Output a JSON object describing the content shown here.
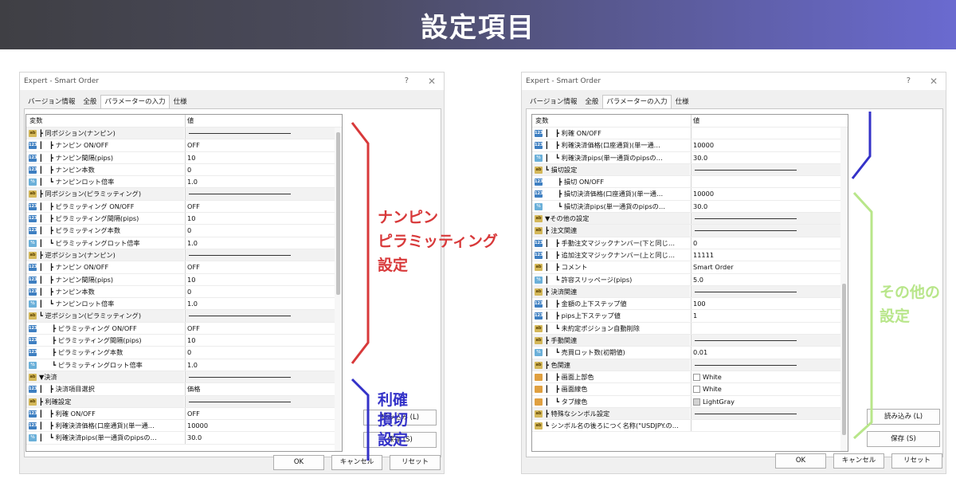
{
  "banner": {
    "title": "設定項目"
  },
  "colors": {
    "red": "#d8393a",
    "blue": "#3432c8",
    "green": "#b8e68a"
  },
  "left_dialog": {
    "title": "Expert - Smart Order",
    "help": "?",
    "close": "✕",
    "tabs": [
      "バージョン情報",
      "全般",
      "パラメーターの入力",
      "仕様"
    ],
    "active_tab": 2,
    "header": {
      "name": "変数",
      "value": "値"
    },
    "rows": [
      {
        "icon": "ab",
        "indent": "┣",
        "name": "同ポジション(ナンピン)",
        "value": "",
        "sep": true
      },
      {
        "icon": "123",
        "indent": "┃　┣",
        "name": "ナンピン ON/OFF",
        "value": "OFF"
      },
      {
        "icon": "123",
        "indent": "┃　┣",
        "name": "ナンピン間隔(pips)",
        "value": "10"
      },
      {
        "icon": "123",
        "indent": "┃　┣",
        "name": "ナンピン本数",
        "value": "0"
      },
      {
        "icon": "½",
        "indent": "┃　┗",
        "name": "ナンピンロット倍率",
        "value": "1.0"
      },
      {
        "icon": "ab",
        "indent": "┣",
        "name": "同ポジション(ピラミッティング)",
        "value": "",
        "sep": true
      },
      {
        "icon": "123",
        "indent": "┃　┣",
        "name": "ピラミッティング ON/OFF",
        "value": "OFF"
      },
      {
        "icon": "123",
        "indent": "┃　┣",
        "name": "ピラミッティング間隔(pips)",
        "value": "10"
      },
      {
        "icon": "123",
        "indent": "┃　┣",
        "name": "ピラミッティング本数",
        "value": "0"
      },
      {
        "icon": "½",
        "indent": "┃　┗",
        "name": "ピラミッティングロット倍率",
        "value": "1.0"
      },
      {
        "icon": "ab",
        "indent": "┣",
        "name": "逆ポジション(ナンピン)",
        "value": "",
        "sep": true
      },
      {
        "icon": "123",
        "indent": "┃　┣",
        "name": "ナンピン ON/OFF",
        "value": "OFF"
      },
      {
        "icon": "123",
        "indent": "┃　┣",
        "name": "ナンピン間隔(pips)",
        "value": "10"
      },
      {
        "icon": "123",
        "indent": "┃　┣",
        "name": "ナンピン本数",
        "value": "0"
      },
      {
        "icon": "½",
        "indent": "┃　┗",
        "name": "ナンピンロット倍率",
        "value": "1.0"
      },
      {
        "icon": "ab",
        "indent": "┗",
        "name": "逆ポジション(ピラミッティング)",
        "value": "",
        "sep": true
      },
      {
        "icon": "123",
        "indent": "　　┣",
        "name": "ピラミッティング ON/OFF",
        "value": "OFF"
      },
      {
        "icon": "123",
        "indent": "　　┣",
        "name": "ピラミッティング間隔(pips)",
        "value": "10"
      },
      {
        "icon": "123",
        "indent": "　　┣",
        "name": "ピラミッティング本数",
        "value": "0"
      },
      {
        "icon": "½",
        "indent": "　　┗",
        "name": "ピラミッティングロット倍率",
        "value": "1.0"
      },
      {
        "icon": "ab",
        "indent": "",
        "name": "▼決済",
        "value": "",
        "sep": true
      },
      {
        "icon": "123",
        "indent": "┃　┣",
        "name": "決済項目選択",
        "value": "価格"
      },
      {
        "icon": "ab",
        "indent": "┣",
        "name": "利確設定",
        "value": "",
        "sep": true
      },
      {
        "icon": "123",
        "indent": "┃　┣",
        "name": "利確 ON/OFF",
        "value": "OFF"
      },
      {
        "icon": "123",
        "indent": "┃　┣",
        "name": "利確決済価格(口座通貨)(単一通…",
        "value": "10000"
      },
      {
        "icon": "½",
        "indent": "┃　┗",
        "name": "利確決済pips(単一通貨のpipsの…",
        "value": "30.0"
      }
    ],
    "load_button": "読み込み (L)",
    "save_button": "保存 (S)",
    "ok_button": "OK",
    "cancel_button": "キャンセル",
    "reset_button": "リセット"
  },
  "right_dialog": {
    "title": "Expert - Smart Order",
    "help": "?",
    "close": "✕",
    "tabs": [
      "バージョン情報",
      "全般",
      "パラメーターの入力",
      "仕様"
    ],
    "active_tab": 2,
    "header": {
      "name": "変数",
      "value": "値"
    },
    "rows": [
      {
        "icon": "123",
        "indent": "┃　┣",
        "name": "利確 ON/OFF",
        "value": ""
      },
      {
        "icon": "123",
        "indent": "┃　┣",
        "name": "利確決済価格(口座通貨)(単一通…",
        "value": "10000"
      },
      {
        "icon": "½",
        "indent": "┃　┗",
        "name": "利確決済pips(単一通貨のpipsの…",
        "value": "30.0"
      },
      {
        "icon": "ab",
        "indent": "┗",
        "name": "損切設定",
        "value": "",
        "sep": true
      },
      {
        "icon": "123",
        "indent": "　　┣",
        "name": "損切 ON/OFF",
        "value": ""
      },
      {
        "icon": "123",
        "indent": "　　┣",
        "name": "損切決済価格(口座通貨)(単一通…",
        "value": "10000"
      },
      {
        "icon": "½",
        "indent": "　　┗",
        "name": "損切決済pips(単一通貨のpipsの…",
        "value": "30.0"
      },
      {
        "icon": "ab",
        "indent": "",
        "name": "▼その他の設定",
        "value": "",
        "sep": true
      },
      {
        "icon": "ab",
        "indent": "┣",
        "name": "注文関連",
        "value": "",
        "sep": true
      },
      {
        "icon": "123",
        "indent": "┃　┣",
        "name": "手動注文マジックナンバー(下と同じ…",
        "value": "0"
      },
      {
        "icon": "123",
        "indent": "┃　┣",
        "name": "追加注文マジックナンバー(上と同じ…",
        "value": "11111"
      },
      {
        "icon": "ab",
        "indent": "┃　┣",
        "name": "コメント",
        "value": "Smart Order"
      },
      {
        "icon": "½",
        "indent": "┃　┗",
        "name": "許容スリッページ(pips)",
        "value": "5.0"
      },
      {
        "icon": "ab",
        "indent": "┣",
        "name": "決済関連",
        "value": "",
        "sep": true
      },
      {
        "icon": "123",
        "indent": "┃　┣",
        "name": "金額の上下ステップ値",
        "value": "100"
      },
      {
        "icon": "123",
        "indent": "┃　┣",
        "name": "pips上下ステップ値",
        "value": "1"
      },
      {
        "icon": "ab",
        "indent": "┃　┗",
        "name": "未約定ポジション自動削除",
        "value": ""
      },
      {
        "icon": "ab",
        "indent": "┣",
        "name": "手動関連",
        "value": "",
        "sep": true
      },
      {
        "icon": "½",
        "indent": "┃　┗",
        "name": "売買ロット数(初期値)",
        "value": "0.01"
      },
      {
        "icon": "ab",
        "indent": "┣",
        "name": "色関連",
        "value": "",
        "sep": true
      },
      {
        "icon": "col",
        "indent": "┃　┣",
        "name": "画面上部色",
        "value": "White",
        "swatch": "#ffffff"
      },
      {
        "icon": "col",
        "indent": "┃　┣",
        "name": "画面線色",
        "value": "White",
        "swatch": "#ffffff"
      },
      {
        "icon": "col",
        "indent": "┃　┗",
        "name": "タブ線色",
        "value": "LightGray",
        "swatch": "#d3d3d3"
      },
      {
        "icon": "ab",
        "indent": "┣",
        "name": "特殊なシンボル設定",
        "value": "",
        "sep": true
      },
      {
        "icon": "ab",
        "indent": "┗",
        "name": "シンボル名の後ろにつく名称(\"USDJPY.の…",
        "value": ""
      }
    ],
    "load_button": "読み込み (L)",
    "save_button": "保存 (S)",
    "ok_button": "OK",
    "cancel_button": "キャンセル",
    "reset_button": "リセット"
  },
  "annotations": {
    "nanpin": [
      "ナンピン",
      "ピラミッティング",
      "設定"
    ],
    "sl_tp": [
      "利確",
      "損切",
      "設定"
    ],
    "other": [
      "その他の",
      "設定"
    ]
  }
}
